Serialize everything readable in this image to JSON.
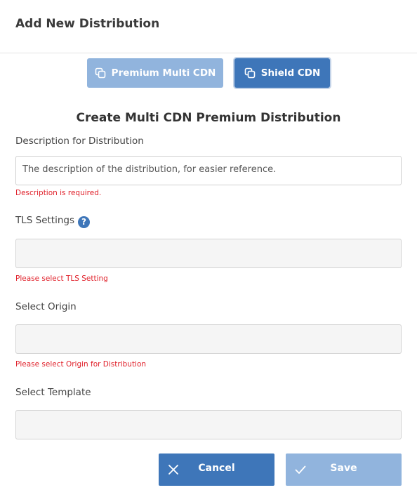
{
  "modal": {
    "title": "Add New Distribution"
  },
  "type_toggle": {
    "premium_label": "Premium Multi CDN",
    "shield_label": "Shield CDN",
    "icon": "copy-icon"
  },
  "form": {
    "title": "Create Multi CDN Premium Distribution",
    "description": {
      "label": "Description for Distribution",
      "placeholder": "The description of the distribution, for easier reference.",
      "error": "Description is required."
    },
    "tls": {
      "label": "TLS Settings",
      "help_icon": "?",
      "value": "",
      "error": "Please select TLS Setting"
    },
    "origin": {
      "label": "Select Origin",
      "value": "",
      "error": "Please select Origin for Distribution"
    },
    "template": {
      "label": "Select Template",
      "value": ""
    }
  },
  "actions": {
    "cancel_label": "Cancel",
    "save_label": "Save"
  },
  "colors": {
    "primary": "#3e76b9",
    "primary_light": "#91b4dd",
    "error": "#e0202a"
  }
}
